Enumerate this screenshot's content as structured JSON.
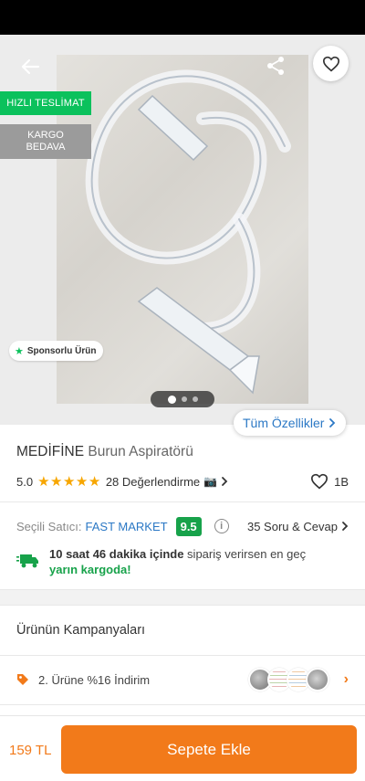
{
  "hero": {
    "badge_fast": "HIZLI TESLİMAT",
    "badge_cargo": "KARGO\nBEDAVA",
    "sponsored": "Sponsorlu Ürün",
    "image_count": 3,
    "active_image": 1,
    "all_features": "Tüm Özellikler"
  },
  "product": {
    "brand": "MEDİFİNE",
    "name": "Burun Aspiratörü",
    "rating": "5.0",
    "stars": "★★★★★",
    "reviews": "28 Değerlendirme",
    "likes": "1B"
  },
  "seller": {
    "label": "Seçili Satıcı:",
    "name": "FAST MARKET",
    "score": "9.5",
    "qa": "35 Soru & Cevap"
  },
  "delivery": {
    "time": "10 saat 46 dakika içinde",
    "text": " sipariş verirsen en geç ",
    "when": "yarın kargoda!"
  },
  "campaigns": {
    "title": "Ürünün Kampanyaları",
    "promo": "2. Ürüne %16 İndirim"
  },
  "bottom": {
    "price": "159 TL",
    "add_to_cart": "Sepete Ekle"
  },
  "colors": {
    "accent": "#f27a1a",
    "green": "#17a24a",
    "link": "#2b78c5",
    "star": "#f7a600"
  }
}
